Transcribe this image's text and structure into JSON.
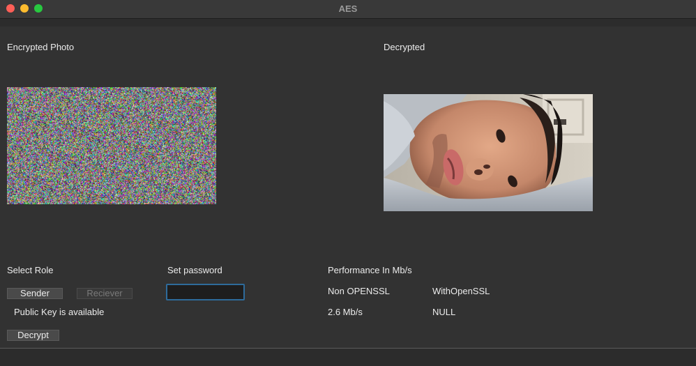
{
  "window": {
    "title": "AES"
  },
  "encrypted": {
    "label": "Encrypted Photo"
  },
  "decrypted": {
    "label": "Decrypted"
  },
  "role": {
    "label": "Select Role",
    "sender_label": "Sender",
    "receiver_label": "Reciever",
    "public_key_status": "Public Key is available",
    "decrypt_label": "Decrypt"
  },
  "password": {
    "label": "Set password",
    "value": ""
  },
  "performance": {
    "title": "Performance In Mb/s",
    "col_non_openssl": "Non OPENSSL",
    "col_with_openssl": "WithOpenSSL",
    "value_non_openssl": "2.6 Mb/s",
    "value_with_openssl": "NULL"
  },
  "colors": {
    "window_bg": "#323232",
    "titlebar_bg": "#393939",
    "focus_ring": "#2e6b9b",
    "traffic_close": "#fe5f57",
    "traffic_minimize": "#febc2e",
    "traffic_maximize": "#28c840"
  }
}
